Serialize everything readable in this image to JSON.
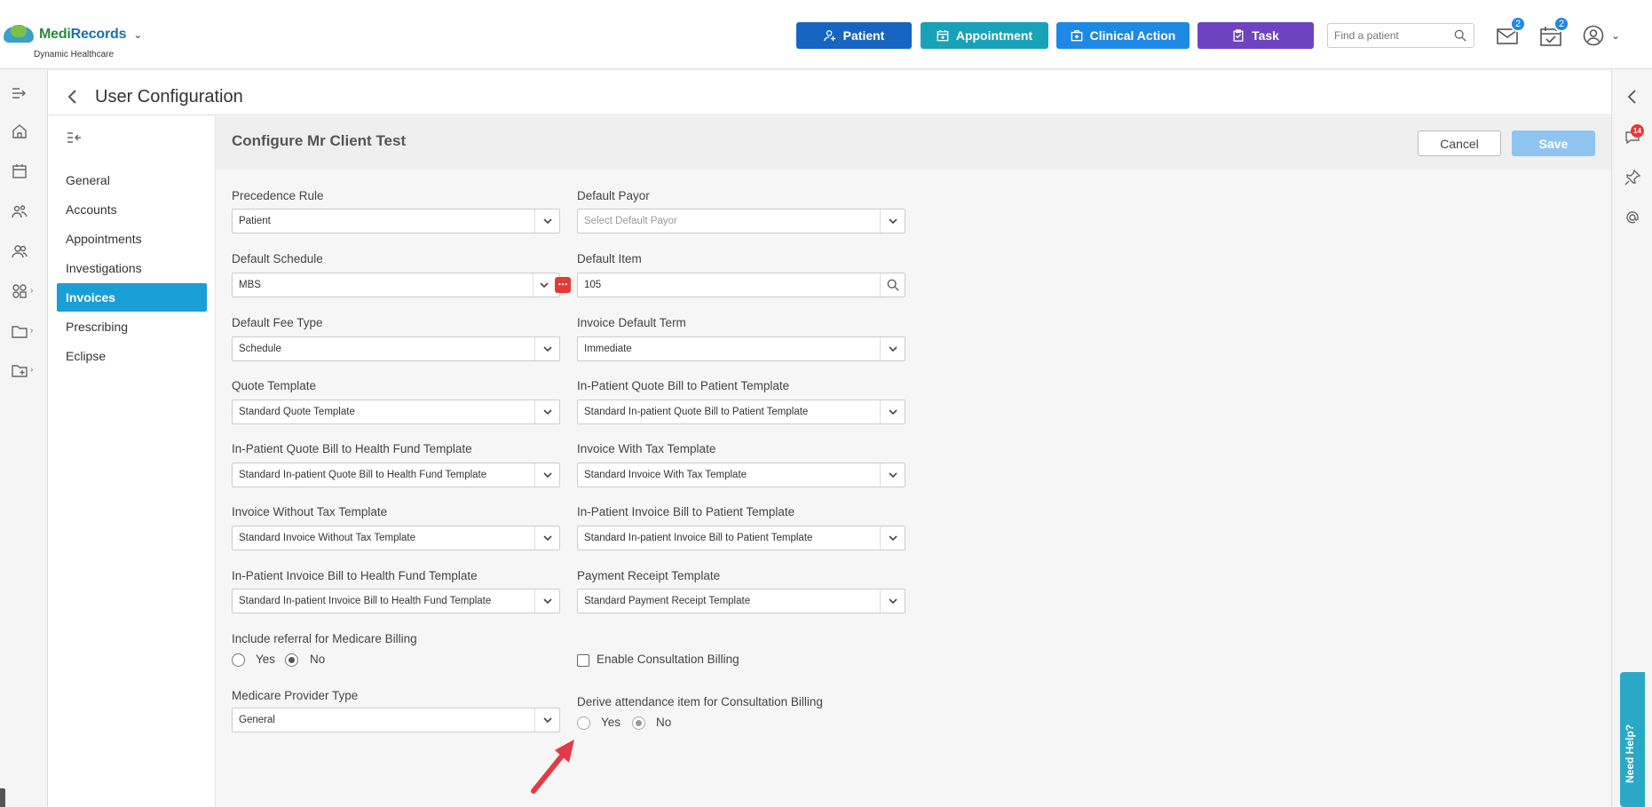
{
  "app": {
    "brand_part1": "Medi",
    "brand_part2": "Records",
    "subtitle": "Dynamic Healthcare"
  },
  "header": {
    "buttons": {
      "patient": "Patient",
      "appointment": "Appointment",
      "clinical_action": "Clinical Action",
      "task": "Task"
    },
    "search_placeholder": "Find a patient",
    "mail_count": "2",
    "tasks_count": "2"
  },
  "right_bar": {
    "chat_count": "14",
    "need_help": "Need Help?"
  },
  "page": {
    "title": "User Configuration"
  },
  "subnav": {
    "items": [
      {
        "label": "General"
      },
      {
        "label": "Accounts"
      },
      {
        "label": "Appointments"
      },
      {
        "label": "Investigations"
      },
      {
        "label": "Invoices"
      },
      {
        "label": "Prescribing"
      },
      {
        "label": "Eclipse"
      }
    ],
    "active": "Invoices"
  },
  "config": {
    "title": "Configure Mr Client Test",
    "cancel_label": "Cancel",
    "save_label": "Save",
    "fields": {
      "precedence_rule": {
        "label": "Precedence Rule",
        "value": "Patient"
      },
      "default_payor": {
        "label": "Default Payor",
        "placeholder": "Select Default Payor"
      },
      "default_schedule": {
        "label": "Default Schedule",
        "value": "MBS"
      },
      "default_item": {
        "label": "Default Item",
        "value": "105"
      },
      "default_fee_type": {
        "label": "Default Fee Type",
        "value": "Schedule"
      },
      "invoice_default_term": {
        "label": "Invoice Default Term",
        "value": "Immediate"
      },
      "quote_template": {
        "label": "Quote Template",
        "value": "Standard Quote Template"
      },
      "inpatient_quote_patient": {
        "label": "In-Patient Quote Bill to Patient Template",
        "value": "Standard In-patient Quote Bill to Patient Template"
      },
      "inpatient_quote_fund": {
        "label": "In-Patient Quote Bill to Health Fund Template",
        "value": "Standard In-patient Quote Bill to Health Fund Template"
      },
      "invoice_with_tax": {
        "label": "Invoice With Tax Template",
        "value": "Standard Invoice With Tax Template"
      },
      "invoice_without_tax": {
        "label": "Invoice Without Tax Template",
        "value": "Standard Invoice Without Tax Template"
      },
      "inpatient_invoice_patient": {
        "label": "In-Patient Invoice Bill to Patient Template",
        "value": "Standard In-patient Invoice Bill to Patient Template"
      },
      "inpatient_invoice_fund": {
        "label": "In-Patient Invoice Bill to Health Fund Template",
        "value": "Standard In-patient Invoice Bill to Health Fund Template"
      },
      "payment_receipt": {
        "label": "Payment Receipt Template",
        "value": "Standard Payment Receipt Template"
      },
      "include_referral": {
        "label": "Include referral for Medicare Billing",
        "yes": "Yes",
        "no": "No",
        "selected": "No"
      },
      "enable_consultation": {
        "label": "Enable Consultation Billing",
        "checked": false
      },
      "medicare_provider_type": {
        "label": "Medicare Provider Type",
        "value": "General"
      },
      "derive_attendance": {
        "label": "Derive attendance item for Consultation Billing",
        "yes": "Yes",
        "no": "No",
        "selected": "No"
      }
    }
  },
  "colors": {
    "patient_btn": "#1565c0",
    "appointment_btn": "#17a2b8",
    "clinical_btn": "#1e88e5",
    "task_btn": "#6f42c1",
    "active_nav": "#1a9ed6",
    "save_btn": "#90c4f0",
    "arrow": "#e53945"
  }
}
